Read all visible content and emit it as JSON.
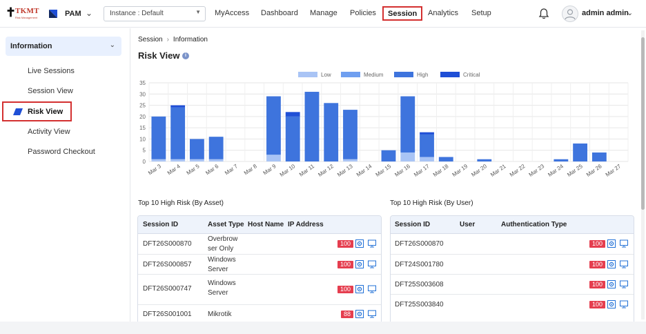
{
  "header": {
    "logo_text": "TKMT",
    "logo_subtext": "Risk Management",
    "product": "PAM",
    "instance_select": "Instance : Default",
    "nav": [
      "MyAccess",
      "Dashboard",
      "Manage",
      "Policies",
      "Session",
      "Analytics",
      "Setup"
    ],
    "active_nav": "Session",
    "user_name": "admin admin"
  },
  "sidebar": {
    "section": "Information",
    "items": [
      "Live Sessions",
      "Session View",
      "Risk View",
      "Activity View",
      "Password Checkout"
    ],
    "active": "Risk View"
  },
  "main": {
    "breadcrumb": [
      "Session",
      "Information"
    ],
    "title": "Risk View",
    "info_icon": "i",
    "asset_table_title": "Top 10 High Risk (By Asset)",
    "user_table_title": "Top 10 High Risk (By User)"
  },
  "chart_data": {
    "type": "bar",
    "stacked": true,
    "categories": [
      "Mar 3",
      "Mar 4",
      "Mar 5",
      "Mar 6",
      "Mar 7",
      "Mar 8",
      "Mar 9",
      "Mar 10",
      "Mar 11",
      "Mar 12",
      "Mar 13",
      "Mar 14",
      "Mar 15",
      "Mar 16",
      "Mar 17",
      "Mar 18",
      "Mar 19",
      "Mar 20",
      "Mar 21",
      "Mar 22",
      "Mar 23",
      "Mar 24",
      "Mar 25",
      "Mar 26",
      "Mar 27"
    ],
    "series": [
      {
        "name": "Low",
        "color": "#a9c4f5",
        "values": [
          1,
          1,
          1,
          1,
          0,
          0,
          3,
          0,
          0,
          0,
          1,
          0,
          0,
          4,
          2,
          0,
          0,
          0,
          0,
          0,
          0,
          0,
          0,
          0,
          0
        ]
      },
      {
        "name": "Medium",
        "color": "#6f9ff0",
        "values": [
          0,
          0,
          0,
          0,
          0,
          0,
          0,
          0,
          0,
          0,
          0,
          0,
          0,
          0,
          0,
          0,
          0,
          0,
          0,
          0,
          0,
          0,
          0,
          0,
          0
        ]
      },
      {
        "name": "High",
        "color": "#3e74dd",
        "values": [
          19,
          23,
          9,
          10,
          0,
          0,
          26,
          20,
          31,
          26,
          22,
          0,
          5,
          25,
          10,
          2,
          0,
          1,
          0,
          0,
          0,
          1,
          8,
          4,
          0
        ]
      },
      {
        "name": "Critical",
        "color": "#1f4fd6",
        "values": [
          0,
          1,
          0,
          0,
          0,
          0,
          0,
          2,
          0,
          0,
          0,
          0,
          0,
          0,
          1,
          0,
          0,
          0,
          0,
          0,
          0,
          0,
          0,
          0,
          0
        ]
      }
    ],
    "ylim": [
      0,
      35
    ],
    "yticks": [
      0,
      5,
      10,
      15,
      20,
      25,
      30,
      35
    ],
    "grid": true,
    "legend_position": "top"
  },
  "asset_table": {
    "columns": [
      "Session ID",
      "Asset Type",
      "Host Name",
      "IP Address"
    ],
    "rows": [
      {
        "session_id": "DFT26S000870",
        "asset_type": "Overbrow ser Only",
        "host": "",
        "ip": "",
        "risk": "100"
      },
      {
        "session_id": "DFT26S000857",
        "asset_type": "Windows Server",
        "host": "",
        "ip": "",
        "risk": "100"
      },
      {
        "session_id": "DFT26S000747",
        "asset_type": "Windows Server",
        "host": "",
        "ip": "",
        "risk": "100"
      },
      {
        "session_id": "DFT26S001001",
        "asset_type": "Mikrotik",
        "host": "",
        "ip": "",
        "risk": "88"
      }
    ]
  },
  "user_table": {
    "columns": [
      "Session ID",
      "User",
      "Authentication Type"
    ],
    "rows": [
      {
        "session_id": "DFT26S000870",
        "user": "",
        "auth": "",
        "risk": "100"
      },
      {
        "session_id": "DFT24S001780",
        "user": "",
        "auth": "",
        "risk": "100"
      },
      {
        "session_id": "DFT25S003608",
        "user": "",
        "auth": "",
        "risk": "100"
      },
      {
        "session_id": "DFT25S003840",
        "user": "",
        "auth": "",
        "risk": "100"
      }
    ]
  },
  "colors": {
    "accent": "#3e74dd",
    "risk_badge": "#e53e4f",
    "highlight_border": "#d32f2f",
    "action_icon": "#1f6fd6"
  }
}
